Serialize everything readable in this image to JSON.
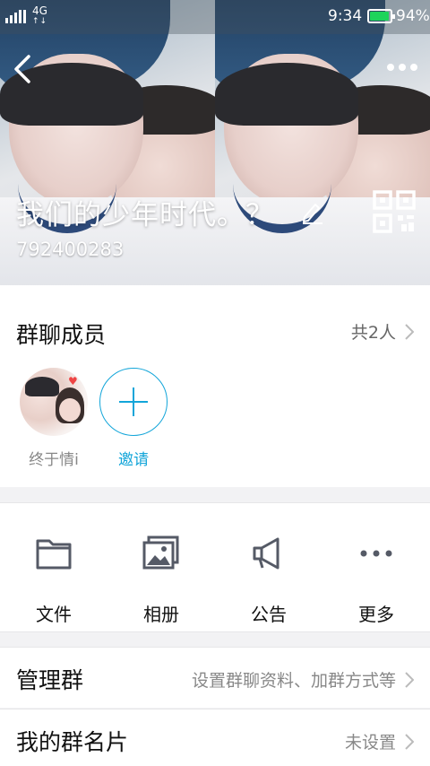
{
  "status_bar": {
    "network": "4G",
    "time": "9:34",
    "battery": "94%",
    "battery_level": 0.94,
    "battery_color": "#1ed45b"
  },
  "header": {
    "back_icon": "back-arrow-icon",
    "more_icon": "more-dots-icon",
    "group_name": "我们的少年时代。？",
    "group_id": "792400283",
    "edit_icon": "pencil-icon",
    "qr_icon": "qr-code-icon"
  },
  "members": {
    "title": "群聊成员",
    "count": "共2人",
    "list": [
      {
        "name": "终于情i"
      }
    ],
    "invite_label": "邀请",
    "accent": "#12a5d9"
  },
  "actions": [
    {
      "label": "文件",
      "icon": "folder-icon"
    },
    {
      "label": "相册",
      "icon": "photo-album-icon"
    },
    {
      "label": "公告",
      "icon": "megaphone-icon"
    },
    {
      "label": "更多",
      "icon": "more-dots-icon"
    }
  ],
  "rows": [
    {
      "title": "管理群",
      "value": "设置群聊资料、加群方式等"
    },
    {
      "title": "我的群名片",
      "value": "未设置"
    }
  ]
}
